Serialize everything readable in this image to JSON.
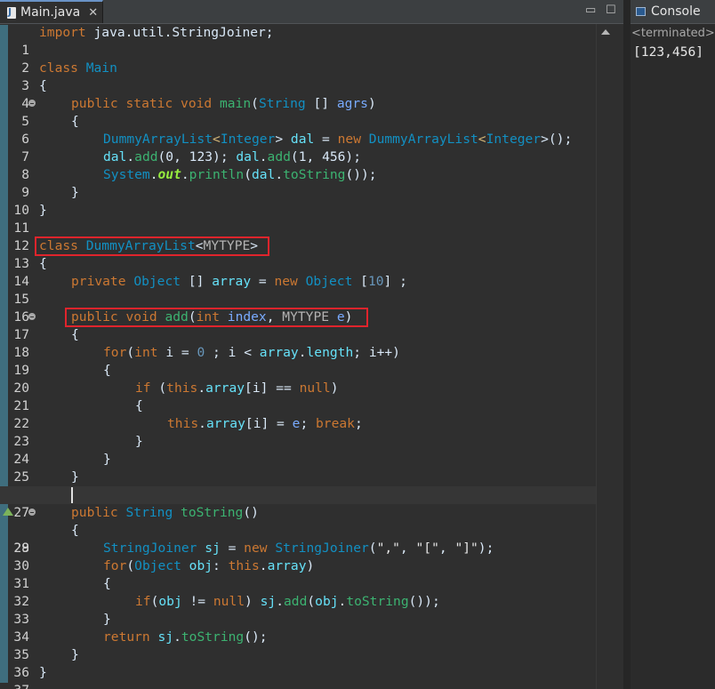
{
  "editor": {
    "tab_label": "Main.java",
    "tab_close": "✕",
    "minimize": "▭",
    "maximize": "☐"
  },
  "line_numbers": [
    "1",
    "2",
    "3",
    "4",
    "5",
    "6",
    "7",
    "8",
    "9",
    "10",
    "11",
    "12",
    "13",
    "14",
    "15",
    "16",
    "17",
    "18",
    "19",
    "20",
    "21",
    "22",
    "23",
    "24",
    "25",
    "26",
    "27",
    "28",
    "29",
    "30",
    "31",
    "32",
    "33",
    "34",
    "35",
    "36",
    "37"
  ],
  "code": {
    "l1": [
      "import",
      " java.util.StringJoiner;"
    ],
    "l3": [
      "class",
      " ",
      "Main"
    ],
    "l4": "{",
    "l5": [
      "public",
      " ",
      "static",
      " ",
      "void",
      " ",
      "main",
      "(",
      "String",
      " [] ",
      "agrs",
      ")"
    ],
    "l6": "{",
    "l7": [
      "DummyArrayList",
      "<",
      "Integer",
      "> ",
      "dal",
      " = ",
      "new",
      " ",
      "DummyArrayList",
      "<",
      "Integer",
      ">();"
    ],
    "l8": [
      "dal",
      ".",
      "add",
      "(0, ",
      "123",
      "); ",
      "dal",
      ".",
      "add",
      "(1, ",
      "456",
      ");"
    ],
    "l9": [
      "System",
      ".",
      "out",
      ".",
      "println",
      "(",
      "dal",
      ".",
      "toString",
      "());"
    ],
    "l10": "}",
    "l11": "}",
    "l13": [
      "class",
      " ",
      "DummyArrayList",
      "<",
      "MYTYPE",
      ">"
    ],
    "l14": "{",
    "l15": [
      "private",
      " ",
      "Object",
      " [] ",
      "array",
      " = ",
      "new",
      " ",
      "Object",
      " [",
      "10",
      "] ;"
    ],
    "l17": [
      "public",
      " ",
      "void",
      " ",
      "add",
      "(",
      "int",
      " ",
      "index",
      ", ",
      "MYTYPE",
      " ",
      "e",
      ")"
    ],
    "l18": "{",
    "l19": [
      "for",
      "(",
      "int",
      " ",
      "i",
      " = ",
      "0",
      " ; ",
      "i",
      " < ",
      "array",
      ".",
      "length",
      "; ",
      "i",
      "++)"
    ],
    "l20": "{",
    "l21": [
      "if",
      " (",
      "this",
      ".",
      "array",
      "[",
      "i",
      "] == ",
      "null",
      ")"
    ],
    "l22": "{",
    "l23": [
      "this",
      ".",
      "array",
      "[",
      "i",
      "] = ",
      "e",
      "; ",
      "break",
      ";"
    ],
    "l24": "}",
    "l25": "}",
    "l26": "}",
    "l28": [
      "public",
      " ",
      "String",
      " ",
      "toString",
      "()"
    ],
    "l29": "{",
    "l30": [
      "StringJoiner",
      " ",
      "sj",
      " = ",
      "new",
      " ",
      "StringJoiner",
      "(",
      "\",\"",
      ", ",
      "\"[\"",
      ", ",
      "\"]\"",
      ");"
    ],
    "l31": [
      "for",
      "(",
      "Object",
      " ",
      "obj",
      ": ",
      "this",
      ".",
      "array",
      ")"
    ],
    "l32": "{",
    "l33": [
      "if",
      "(",
      "obj",
      " != ",
      "null",
      ") ",
      "sj",
      ".",
      "add",
      "(",
      "obj",
      ".",
      "toString",
      "());"
    ],
    "l34": "}",
    "l35": [
      "return",
      " ",
      "sj",
      ".",
      "toString",
      "();"
    ],
    "l36": "}",
    "l37": "}"
  },
  "console": {
    "tab_label": "Console",
    "status": "<terminated>",
    "output": "[123,456]"
  },
  "colors": {
    "highlight_box": "#e0242c",
    "keyword": "#cc7832",
    "class": "#1290c3"
  }
}
